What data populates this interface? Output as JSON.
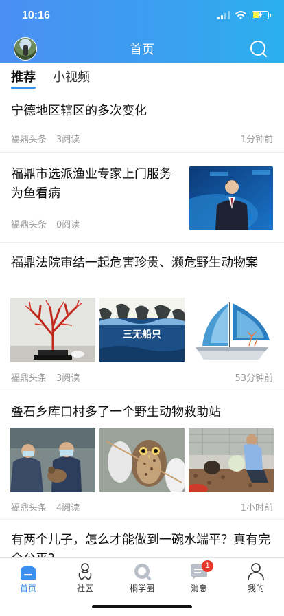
{
  "status_bar": {
    "time": "10:16"
  },
  "header": {
    "title": "首页",
    "avatar_icon": "user-avatar",
    "search_icon": "search-icon"
  },
  "tabs": [
    {
      "label": "推荐",
      "active": true
    },
    {
      "label": "小视频",
      "active": false
    }
  ],
  "articles": [
    {
      "title": "宁德地区辖区的多次变化",
      "source": "福鼎头条",
      "reads": "3阅读",
      "time": "1分钟前",
      "layout": "text"
    },
    {
      "title": "福鼎市选派渔业专家上门服务为鱼看病",
      "source": "福鼎头条",
      "reads": "0阅读",
      "time": "",
      "layout": "right-image",
      "images": [
        "news-anchor"
      ]
    },
    {
      "title": "福鼎法院审结一起危害珍贵、濒危野生动物案",
      "source": "福鼎头条",
      "reads": "3阅读",
      "time": "53分钟前",
      "layout": "three-images",
      "images": [
        "red-coral",
        "三无船只",
        "sailboat-illustration"
      ]
    },
    {
      "title": "叠石乡库口村多了一个野生动物救助站",
      "source": "福鼎头条",
      "reads": "4阅读",
      "time": "1小时前",
      "layout": "three-images",
      "images": [
        "owl-rescue-1",
        "owl-rescue-2",
        "owl-rescue-3"
      ]
    },
    {
      "title": "有两个儿子，怎么才能做到一碗水端平？真有完全公平？",
      "layout": "text"
    }
  ],
  "tab_bar": [
    {
      "label": "首页",
      "icon": "home-icon",
      "active": true
    },
    {
      "label": "社区",
      "icon": "community-icon",
      "active": false
    },
    {
      "label": "桐学圈",
      "icon": "circle-icon",
      "active": false
    },
    {
      "label": "消息",
      "icon": "message-icon",
      "active": false,
      "badge": "1"
    },
    {
      "label": "我的",
      "icon": "profile-icon",
      "active": false
    }
  ],
  "colors": {
    "accent": "#3a8fef",
    "badge": "#e83a2d",
    "header_start": "#4a8ff2",
    "header_end": "#2bb0ee"
  }
}
